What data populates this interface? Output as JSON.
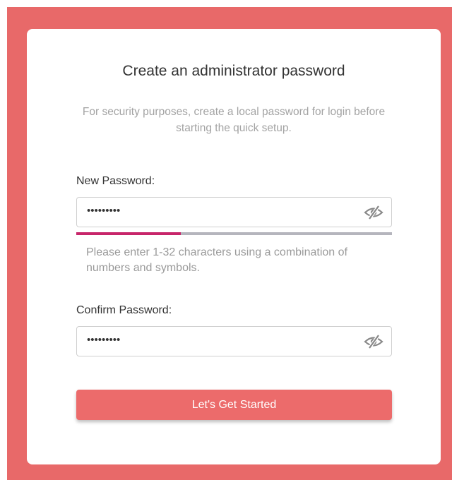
{
  "colors": {
    "background": "#e86969",
    "card": "#ffffff",
    "accent_button": "#ec6b6b",
    "strength_fill": "#c7266a",
    "strength_track": "#b5b5bd",
    "text_primary": "#333333",
    "text_muted": "#a3a3a3"
  },
  "dialog": {
    "title": "Create an administrator password",
    "subtitle": "For security purposes, create a local password for login before starting the quick setup."
  },
  "new_password": {
    "label": "New Password:",
    "value": "•••••••••",
    "visibility_icon": "eye-slash-icon",
    "strength_level": 0.33,
    "hint": "Please enter 1-32 characters using a combination of numbers and symbols."
  },
  "confirm_password": {
    "label": "Confirm Password:",
    "value": "•••••••••",
    "visibility_icon": "eye-slash-icon"
  },
  "submit": {
    "label": "Let's Get Started"
  }
}
